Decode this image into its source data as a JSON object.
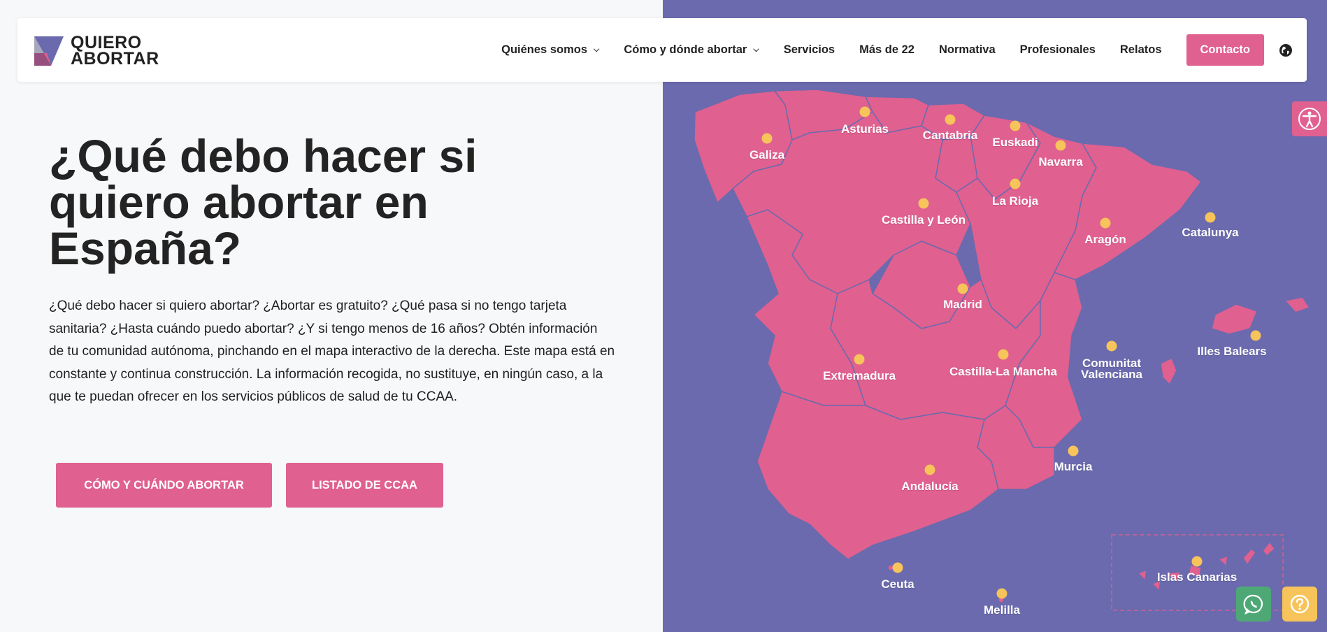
{
  "brand": {
    "line1": "QUIERO",
    "line2": "ABORTAR",
    "colors": {
      "primary": "#e0608f",
      "map_bg": "#6b6aae",
      "marker": "#f6c45a",
      "whatsapp": "#4ea876"
    }
  },
  "nav": {
    "items": [
      {
        "label": "Quiénes somos",
        "dropdown": true
      },
      {
        "label": "Cómo y dónde abortar",
        "dropdown": true
      },
      {
        "label": "Servicios",
        "dropdown": false
      },
      {
        "label": "Más de 22",
        "dropdown": false
      },
      {
        "label": "Normativa",
        "dropdown": false
      },
      {
        "label": "Profesionales",
        "dropdown": false
      },
      {
        "label": "Relatos",
        "dropdown": false
      }
    ],
    "contact": "Contacto",
    "dropdown_glyph": "⌄"
  },
  "hero": {
    "title": "¿Qué debo hacer si quiero abortar en España?",
    "text": "¿Qué debo hacer si quiero abortar? ¿Abortar es gratuito? ¿Qué pasa si no tengo tarjeta sanitaria? ¿Hasta cuándo puedo abortar? ¿Y si tengo menos de 16 años? Obtén información de tu comunidad autónoma, pinchando en el mapa interactivo de la derecha. Este mapa está en constante y continua construcción. La información recogida, no sustituye, en ningún caso, a la que te puedan ofrecer en los servicios públicos de salud de tu CCAA.",
    "buttons": [
      "CÓMO Y CUÁNDO ABORTAR",
      "LISTADO DE CCAA"
    ]
  },
  "map": {
    "regions": [
      {
        "id": "galiza",
        "label": "Galiza"
      },
      {
        "id": "asturias",
        "label": "Asturias"
      },
      {
        "id": "cantabria",
        "label": "Cantabria"
      },
      {
        "id": "euskadi",
        "label": "Euskadi"
      },
      {
        "id": "navarra",
        "label": "Navarra"
      },
      {
        "id": "la-rioja",
        "label": "La Rioja"
      },
      {
        "id": "castilla-y-leon",
        "label": "Castilla y León"
      },
      {
        "id": "aragon",
        "label": "Aragón"
      },
      {
        "id": "catalunya",
        "label": "Catalunya"
      },
      {
        "id": "madrid",
        "label": "Madrid"
      },
      {
        "id": "illes-balears",
        "label": "Illes Balears"
      },
      {
        "id": "extremadura",
        "label": "Extremadura"
      },
      {
        "id": "castilla-la-mancha",
        "label": "Castilla-La Mancha"
      },
      {
        "id": "comunitat-valenciana",
        "label": "Comunitat Valenciana"
      },
      {
        "id": "murcia",
        "label": "Murcia"
      },
      {
        "id": "andalucia",
        "label": "Andalucía"
      },
      {
        "id": "islas-canarias",
        "label": "Islas Canarias"
      },
      {
        "id": "ceuta",
        "label": "Ceuta"
      },
      {
        "id": "melilla",
        "label": "Melilla"
      }
    ]
  },
  "icons": {
    "accessibility": "accessibility-icon",
    "whatsapp": "whatsapp-icon",
    "help": "help-icon",
    "language": "globe-icon"
  }
}
